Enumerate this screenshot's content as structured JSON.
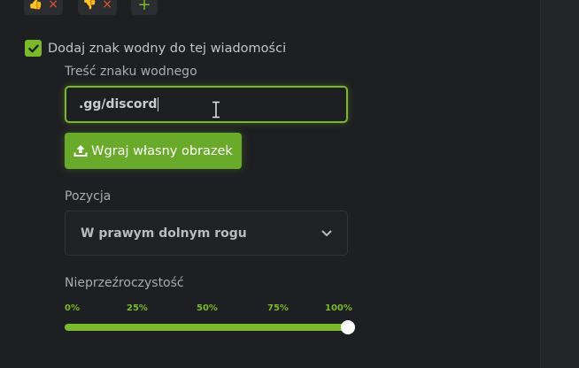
{
  "reactions": [
    {
      "emoji": "👍",
      "remove": "×"
    },
    {
      "emoji": "👎",
      "remove": "×"
    }
  ],
  "add_reaction": "+",
  "watermark": {
    "checkbox_label": "Dodaj znak wodny do tej wiadomości",
    "checked": true,
    "text_label": "Treść znaku wodnego",
    "text_value": ".gg/discord",
    "upload_label": "Wgraj własny obrazek",
    "position_label": "Pozycja",
    "position_value": "W prawym dolnym rogu",
    "opacity_label": "Nieprzeźroczystość",
    "opacity_ticks": [
      "0%",
      "25%",
      "50%",
      "75%",
      "100%"
    ],
    "opacity_value": 1.0
  },
  "colors": {
    "accent": "#7ab92a",
    "button": "#6aaa2a",
    "remove": "#e2562f",
    "background": "#1e1f22"
  },
  "icons": {
    "checkbox": "check-icon",
    "upload": "upload-icon",
    "select": "chevron-down-icon",
    "cursor": "text-cursor-icon"
  }
}
